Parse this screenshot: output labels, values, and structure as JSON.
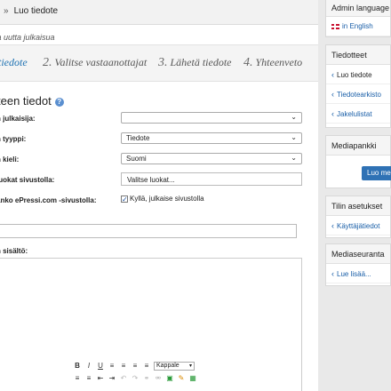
{
  "breadcrumb": {
    "separator": "»",
    "current": "Luo tiedote"
  },
  "form": {
    "subtitle": "sa uutta julkaisua",
    "steps": [
      {
        "num": "",
        "label": "tiedote"
      },
      {
        "num": "2.",
        "label": "Valitse vastaanottajat"
      },
      {
        "num": "3.",
        "label": "Lähetä tiedote"
      },
      {
        "num": "4.",
        "label": "Yhteenveto"
      }
    ],
    "section_title": "teen tiedot",
    "fields": {
      "publisher_label": "n julkaisija:",
      "publisher_value": "",
      "type_label": "n tyyppi:",
      "type_value": "Tiedote",
      "language_label": "n kieli:",
      "language_value": "Suomi",
      "categories_label": "luokat sivustolla:",
      "categories_value": "Valitse luokat...",
      "publish_label": "anko ePressi.com -sivustolla:",
      "publish_check_label": "Kyllä, julkaise sivustolla",
      "publish_checked": true,
      "content_label": "n sisältö:"
    },
    "editor_toolbar": {
      "bold": "B",
      "italic": "I",
      "underline": "U",
      "format_select": "Kappale"
    }
  },
  "sidebar": {
    "admin_language": {
      "title": "Admin language",
      "link": "in English"
    },
    "tiedotteet": {
      "title": "Tiedotteet",
      "items": [
        "Luo tiedote",
        "Tiedotearkisto",
        "Jakelulistat"
      ]
    },
    "mediapankki": {
      "title": "Mediapankki",
      "button": "Luo med"
    },
    "tilin_asetukset": {
      "title": "Tilin asetukset",
      "items": [
        "Käyttäjätiedot"
      ]
    },
    "mediaseuranta": {
      "title": "Mediaseuranta",
      "items": [
        "Lue lisää..."
      ]
    }
  },
  "colors": {
    "accent": "#1a6fb1",
    "button": "#2f72b5"
  }
}
